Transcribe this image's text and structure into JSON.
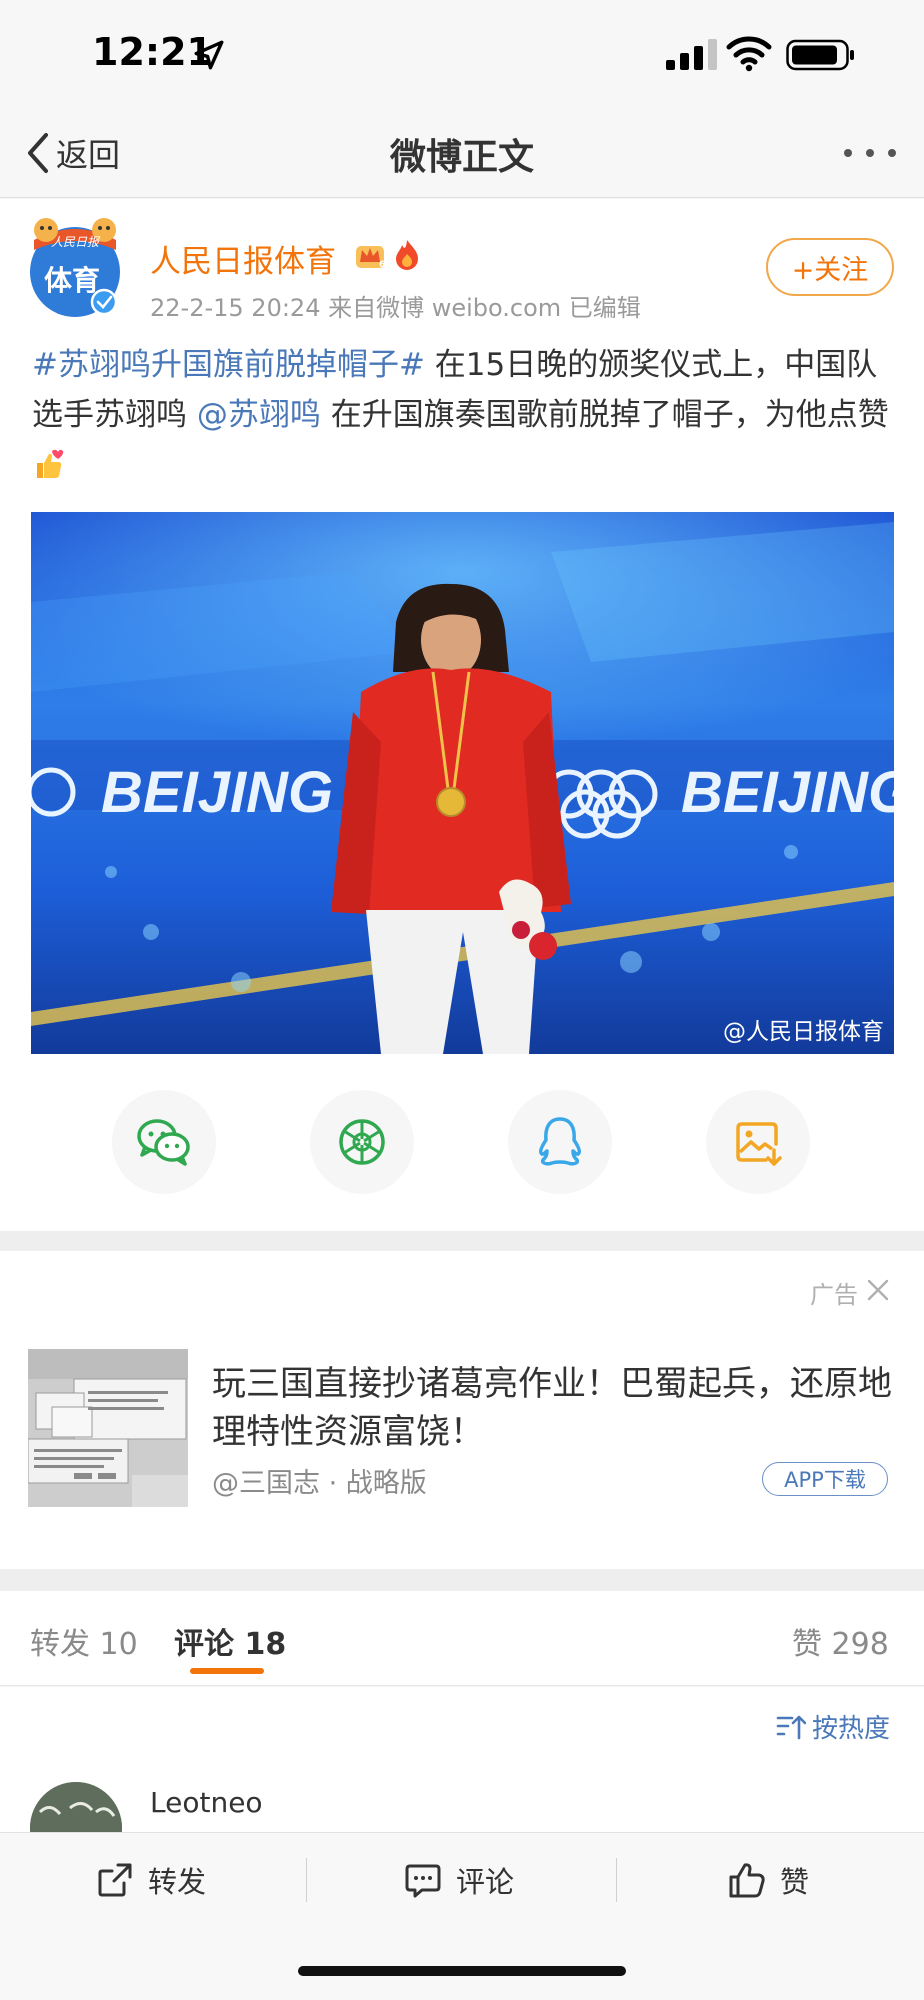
{
  "status_bar": {
    "time": "12:21"
  },
  "navbar": {
    "back_label": "返回",
    "title": "微博正文"
  },
  "post": {
    "author": "人民日报体育",
    "avatar_text": "体育",
    "avatar_top_text": "人民日报",
    "meta": "22-2-15 20:24  来自微博 weibo.com  已编辑",
    "follow_label": "+关注",
    "topic": "#苏翊鸣升国旗前脱掉帽子#",
    "text_part1": " 在15日晚的颁奖仪式上，中国队选手苏翊鸣 ",
    "mention": "@苏翊鸣",
    "text_part2": " 在升国旗奏国歌前脱掉了帽子，为他点赞",
    "image_banner_left": "BEIJING 2",
    "image_banner_right": "BEIJING",
    "watermark": "@人民日报体育"
  },
  "share": [
    {
      "name": "wechat-icon"
    },
    {
      "name": "moments-icon"
    },
    {
      "name": "qq-icon"
    },
    {
      "name": "save-image-icon"
    }
  ],
  "ad": {
    "label": "广告",
    "title": "玩三国直接抄诸葛亮作业！巴蜀起兵，还原地理特性资源富饶！",
    "source": "@三国志 · 战略版",
    "download_label": "APP下载"
  },
  "tabs": {
    "repost": "转发 10",
    "comment": "评论 18",
    "like": "赞 298"
  },
  "comments": {
    "sort_label": "按热度",
    "first_commenter": "Leotneo"
  },
  "actions": {
    "repost": "转发",
    "comment": "评论",
    "like": "赞"
  },
  "colors": {
    "accent_orange": "#f2740a",
    "link_blue": "#4a78b8"
  }
}
